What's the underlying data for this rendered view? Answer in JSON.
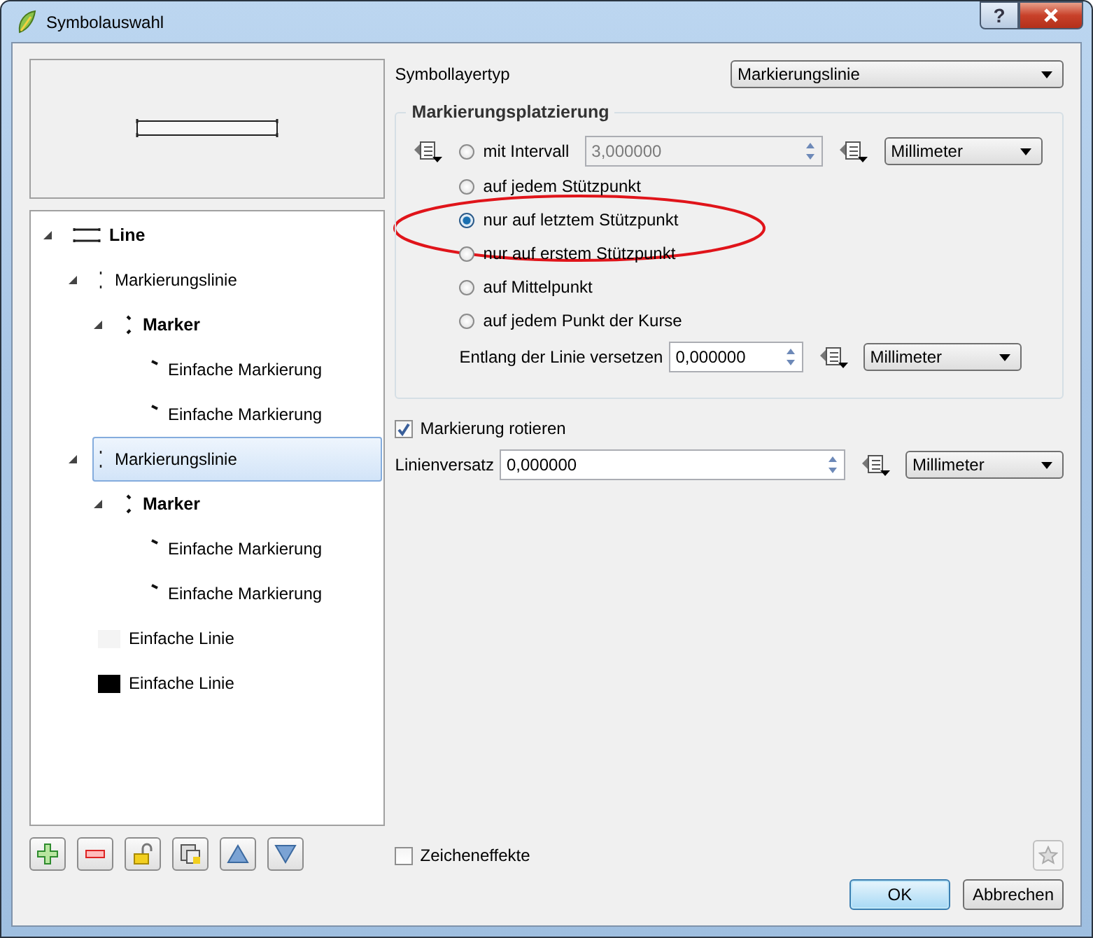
{
  "window": {
    "title": "Symbolauswahl",
    "help_button": "?"
  },
  "tree": [
    {
      "label": "Line",
      "kind": "line",
      "selected": false,
      "expanded": true,
      "children": [
        {
          "label": "Markierungslinie",
          "kind": "marker-line",
          "selected": false,
          "expanded": true,
          "children": [
            {
              "label": "Marker",
              "kind": "marker",
              "selected": false,
              "expanded": true,
              "children": [
                {
                  "label": "Einfache Markierung",
                  "kind": "simple-marker",
                  "selected": false
                },
                {
                  "label": "Einfache Markierung",
                  "kind": "simple-marker",
                  "selected": false
                }
              ]
            }
          ]
        },
        {
          "label": "Markierungslinie",
          "kind": "marker-line",
          "selected": true,
          "expanded": true,
          "children": [
            {
              "label": "Marker",
              "kind": "marker",
              "selected": false,
              "expanded": true,
              "children": [
                {
                  "label": "Einfache Markierung",
                  "kind": "simple-marker",
                  "selected": false
                },
                {
                  "label": "Einfache Markierung",
                  "kind": "simple-marker",
                  "selected": false
                }
              ]
            }
          ]
        },
        {
          "label": "Einfache Linie",
          "kind": "simple-line",
          "selected": false,
          "color": "#f4f4f4"
        },
        {
          "label": "Einfache Linie",
          "kind": "simple-line",
          "selected": false,
          "color": "#000000"
        }
      ]
    }
  ],
  "symbol_layer_type": {
    "label": "Symbollayertyp",
    "value": "Markierungslinie"
  },
  "placement": {
    "title": "Markierungsplatzierung",
    "options": [
      {
        "label": "mit Intervall",
        "selected": false
      },
      {
        "label": "auf jedem Stützpunkt",
        "selected": false
      },
      {
        "label": "nur auf letztem Stützpunkt",
        "selected": true
      },
      {
        "label": "nur auf erstem Stützpunkt",
        "selected": false
      },
      {
        "label": "auf Mittelpunkt",
        "selected": false
      },
      {
        "label": "auf jedem Punkt der Kurse",
        "selected": false
      }
    ],
    "interval": {
      "value": "3,000000",
      "disabled": true,
      "unit": "Millimeter"
    },
    "offset_along": {
      "label": "Entlang der Linie versetzen",
      "value": "0,000000",
      "unit": "Millimeter"
    }
  },
  "rotate": {
    "label": "Markierung rotieren",
    "checked": true
  },
  "line_offset": {
    "label": "Linienversatz",
    "value": "0,000000",
    "unit": "Millimeter"
  },
  "draw_effects": {
    "label": "Zeicheneffekte",
    "checked": false
  },
  "buttons": [
    {
      "label": "OK",
      "default": true
    },
    {
      "label": "Abbrechen",
      "default": false
    }
  ]
}
